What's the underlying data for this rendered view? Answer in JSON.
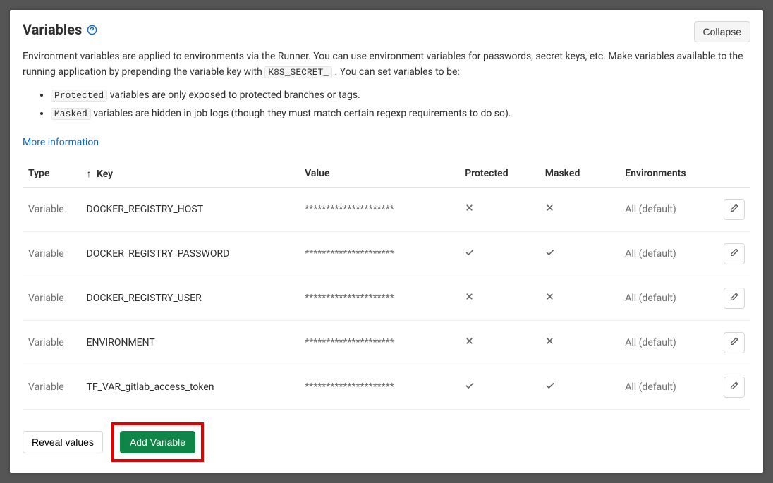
{
  "header": {
    "title": "Variables",
    "collapse": "Collapse"
  },
  "desc": {
    "line1_a": "Environment variables are applied to environments via the Runner. You can use environment variables for passwords, secret keys, etc. Make variables available to the running application by prepending the variable key with ",
    "code1": "K8S_SECRET_",
    "line1_b": ". You can set variables to be:"
  },
  "bullets": {
    "b1_code": "Protected",
    "b1_text": " variables are only exposed to protected branches or tags.",
    "b2_code": "Masked",
    "b2_text": " variables are hidden in job logs (though they must match certain regexp requirements to do so)."
  },
  "moreInfo": "More information",
  "columns": {
    "type": "Type",
    "key": "Key",
    "value": "Value",
    "protected": "Protected",
    "masked": "Masked",
    "environments": "Environments"
  },
  "rows": [
    {
      "type": "Variable",
      "key": "DOCKER_REGISTRY_HOST",
      "value": "*********************",
      "protected": false,
      "masked": false,
      "env": "All (default)"
    },
    {
      "type": "Variable",
      "key": "DOCKER_REGISTRY_PASSWORD",
      "value": "*********************",
      "protected": true,
      "masked": true,
      "env": "All (default)"
    },
    {
      "type": "Variable",
      "key": "DOCKER_REGISTRY_USER",
      "value": "*********************",
      "protected": false,
      "masked": false,
      "env": "All (default)"
    },
    {
      "type": "Variable",
      "key": "ENVIRONMENT",
      "value": "*********************",
      "protected": false,
      "masked": false,
      "env": "All (default)"
    },
    {
      "type": "Variable",
      "key": "TF_VAR_gitlab_access_token",
      "value": "*********************",
      "protected": true,
      "masked": true,
      "env": "All (default)"
    }
  ],
  "footer": {
    "reveal": "Reveal values",
    "add": "Add Variable"
  }
}
